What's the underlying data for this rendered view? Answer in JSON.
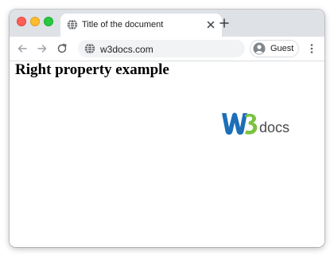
{
  "browser": {
    "tab": {
      "title": "Title of the document",
      "icon": "globe-icon"
    },
    "address_bar": {
      "url": "w3docs.com",
      "icon": "globe-icon"
    },
    "profile": {
      "label": "Guest",
      "icon": "person-icon"
    },
    "traffic_lights": [
      "#ff5f57",
      "#febc2e",
      "#28c840"
    ]
  },
  "page": {
    "heading": "Right property example",
    "logo": {
      "lettering": "W3docs",
      "colors": {
        "w": "#1d6fb8",
        "three": "#7cc242",
        "docs": "#4a4a4a"
      }
    }
  }
}
